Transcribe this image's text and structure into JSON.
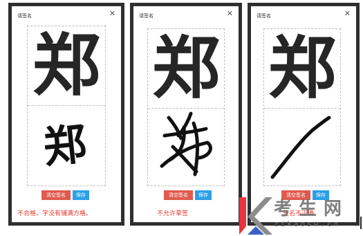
{
  "dialog": {
    "title": "请签名",
    "close_glyph": "✕",
    "reference_char": "郑",
    "clear_label": "清空签名",
    "save_label": "保存"
  },
  "panels": [
    {
      "message": "不合格，字没有铺满方格。",
      "handwriting": "郑"
    },
    {
      "message": "不允许草签"
    },
    {
      "message": "签名不正确"
    }
  ],
  "watermark": {
    "text": "考生网",
    "url": "zikaosw.cn",
    "colors": {
      "red": "#e8343c",
      "gray": "#8c8c8c"
    }
  },
  "colors": {
    "clear_button": "#e05a4f",
    "save_button": "#2d9fe6",
    "error_text": "#e63a2e",
    "frame": "#2f2f2f"
  }
}
